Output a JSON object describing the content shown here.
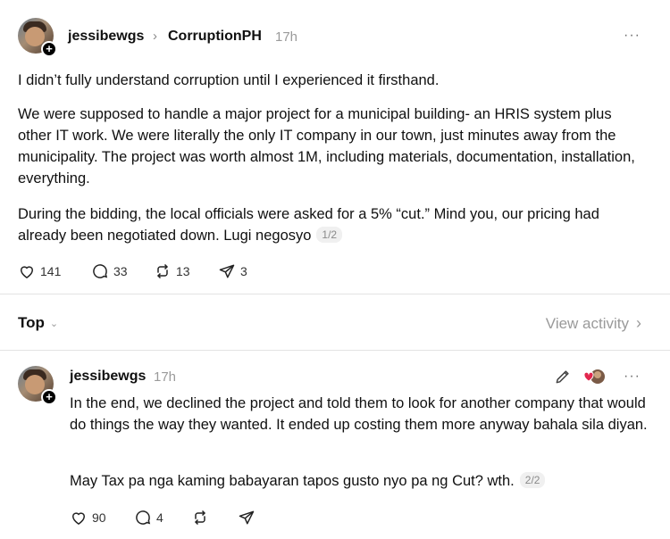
{
  "post": {
    "username": "jessibewgs",
    "community": "CorruptionPH",
    "time": "17h",
    "more_label": "···",
    "paragraphs": [
      "I didn’t fully understand corruption until I experienced it firsthand.",
      "We were supposed to handle a major project for a municipal building- an HRIS system plus other IT work. We were literally the only IT company in our town, just minutes away from the municipality. The project was worth almost 1M, including materials, documentation, installation, everything.",
      "During the bidding, the local officials were asked for a 5% “cut.” Mind you, our pricing had already been negotiated down. Lugi negosyo"
    ],
    "page_indicator": "1/2",
    "likes": "141",
    "replies": "33",
    "reposts": "13",
    "shares": "3"
  },
  "sort": {
    "label": "Top",
    "view_activity": "View activity"
  },
  "reply": {
    "username": "jessibewgs",
    "time": "17h",
    "more_label": "···",
    "paragraphs": [
      "In the end, we declined the project and told them to look for another company that would do things the way they wanted. It ended up costing them more anyway bahala sila diyan.",
      "May Tax pa nga kaming babayaran tapos gusto nyo pa ng Cut? wth."
    ],
    "page_indicator": "2/2",
    "likes": "90",
    "replies": "4"
  },
  "icons": {
    "heart": "heart-icon",
    "comment": "comment-icon",
    "repost": "repost-icon",
    "share": "share-icon",
    "edit": "pencil-icon",
    "chevron": "chevron-right-icon"
  },
  "colors": {
    "text": "#101010",
    "muted": "#9a9a9a",
    "divider": "#e3e3e3",
    "pill_bg": "#f0f0f0"
  }
}
